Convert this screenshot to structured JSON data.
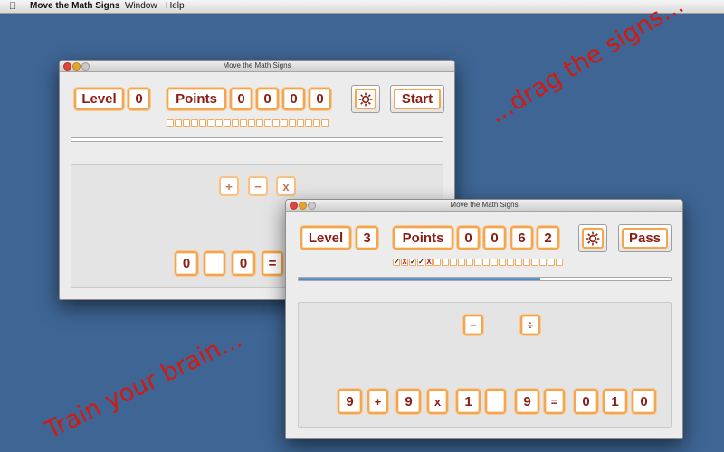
{
  "menubar": {
    "app": "Move the Math Signs",
    "items": [
      "Window",
      "Help"
    ]
  },
  "window_back": {
    "title": "Move the Math Signs",
    "level_label": "Level",
    "level_value": "0",
    "points_label": "Points",
    "points_digits": [
      "0",
      "0",
      "0",
      "0"
    ],
    "start_label": "Start",
    "progress_fraction": 0,
    "signs": [
      "+",
      "−",
      "x"
    ],
    "equation": [
      "0",
      "",
      "0",
      "="
    ]
  },
  "window_front": {
    "title": "Move the Math Signs",
    "level_label": "Level",
    "level_value": "3",
    "points_label": "Points",
    "points_digits": [
      "0",
      "0",
      "6",
      "2"
    ],
    "pass_label": "Pass",
    "progress_fraction": 0.65,
    "results": [
      "✓",
      "X",
      "✓",
      "✓",
      "X"
    ],
    "signs": [
      "−",
      "÷"
    ],
    "equation": [
      "9",
      "+",
      "9",
      "x",
      "1",
      "",
      "9",
      "=",
      "0",
      "1",
      "0"
    ]
  },
  "captions": {
    "drag": "...drag the signs...",
    "train": "Train your brain..."
  },
  "icons": {
    "apple": "apple-icon",
    "settings": "gear-icon"
  },
  "colors": {
    "accent_orange": "#f3a64f",
    "text_red": "#8b1e14",
    "caption_red": "#d11a12",
    "desktop": "#3e6594"
  }
}
